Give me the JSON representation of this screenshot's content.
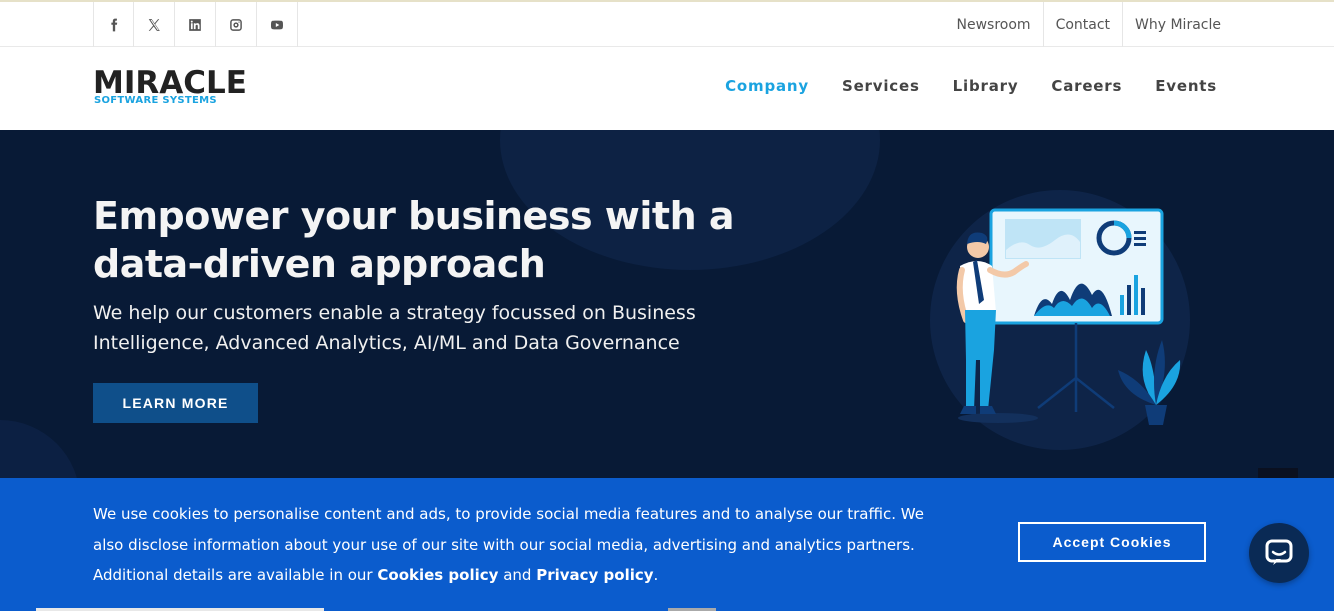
{
  "topbar": {
    "social": [
      {
        "icon": "facebook-icon"
      },
      {
        "icon": "x-twitter-icon"
      },
      {
        "icon": "linkedin-icon"
      },
      {
        "icon": "instagram-icon"
      },
      {
        "icon": "youtube-icon"
      }
    ],
    "links": [
      "Newsroom",
      "Contact",
      "Why Miracle"
    ]
  },
  "logo": {
    "word": "MIRACLE",
    "sub": "SOFTWARE SYSTEMS"
  },
  "nav": {
    "items": [
      "Company",
      "Services",
      "Library",
      "Careers",
      "Events"
    ],
    "active": "Company"
  },
  "hero": {
    "title": "Empower your business with a data-driven approach",
    "lead": "We help our customers enable a strategy focussed on Business Intelligence, Advanced Analytics, AI/ML and Data Governance",
    "cta": "LEARN MORE"
  },
  "cookie": {
    "text_before": "We use cookies to personalise content and ads, to provide social media features and to analyse our traffic. We also disclose information about your use of our site with our social media, advertising and analytics partners. Additional details are available in our ",
    "cookies_policy": "Cookies policy",
    "and": " and ",
    "privacy_policy": "Privacy policy",
    "end": ".",
    "accept": "Accept Cookies"
  },
  "colors": {
    "accent": "#1aa3e0",
    "hero_bg": "#081a36",
    "cookie_bg": "#0b5ccd",
    "cta_bg": "#0f4f8a"
  }
}
